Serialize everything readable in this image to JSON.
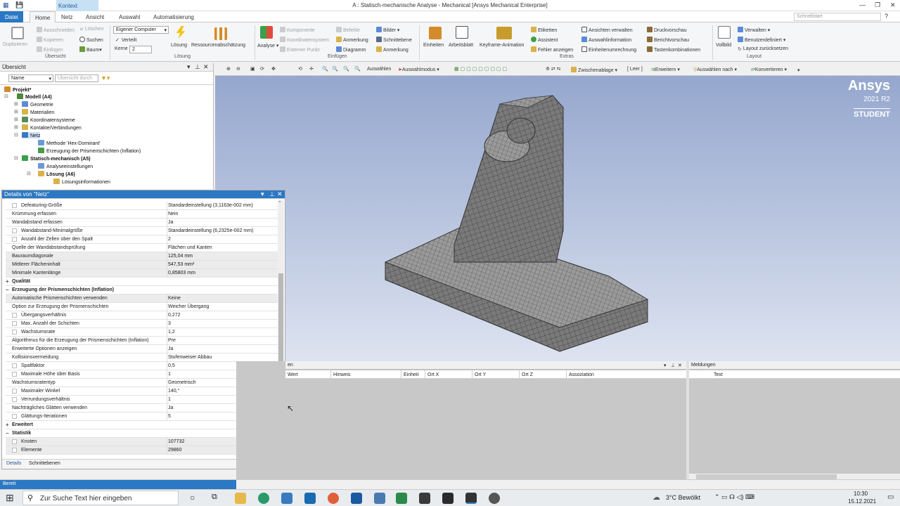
{
  "window": {
    "title": "A : Statisch-mechanische Analyse - Mechanical [Ansys Mechanical Enterprise]",
    "context_tab": "Kontext"
  },
  "tabs": [
    "Datei",
    "Home",
    "Netz",
    "Ansicht",
    "Auswahl",
    "Automatisierung"
  ],
  "search_placeholder": "Schnellstart",
  "ribbon": {
    "duplizieren": "Duplizieren",
    "ausschneiden": "Ausschneiden",
    "kopieren": "Kopieren",
    "einfuegen": "Einfügen",
    "loeschen": "Löschen",
    "suchen": "Suchen",
    "baum": "Baum",
    "uebersicht_grp": "Übersicht",
    "computer_select": "Eigener Computer",
    "verteilt": "Verteilt",
    "kerne_label": "Kerne",
    "kerne_value": "2",
    "loesung": "Lösung",
    "ressourcen": "Ressourcenabschätzung",
    "loesung_grp": "Lösung",
    "analyse": "Analyse",
    "komponente": "Komponente",
    "koordinatensystem": "Koordinatensystem",
    "externer_punkt": "Externer Punkt",
    "befehle": "Befehle",
    "anmerkung": "Anmerkung",
    "diagramm": "Diagramm",
    "bilder": "Bilder",
    "schnittebene": "Schnittebene",
    "anmerkung2": "Anmerkung",
    "einfuegen_grp": "Einfügen",
    "einheiten": "Einheiten",
    "arbeitsblatt": "Arbeitsblatt",
    "keyframe": "Keyframe-Animation",
    "etiketten": "Etiketten",
    "assistent": "Assistent",
    "fehler": "Fehler anzeigen",
    "ansichten": "Ansichten verwalten",
    "auswahlinfo": "Auswahlinformation",
    "einheitenumr": "Einheitenumrechnung",
    "druckvorschau": "Druckvorschau",
    "berichtvorschau": "Berichtvorschau",
    "tastenkomb": "Tastenkombinationen",
    "extras_grp": "Extras",
    "vollbild": "Vollbild",
    "verwalten": "Verwalten",
    "benutzerdef": "Benutzerdefiniert",
    "layout_reset": "Layout zurücksetzen",
    "layout_grp": "Layout"
  },
  "outline": {
    "title": "Übersicht",
    "name_col": "Name",
    "search_placeholder": "Übersicht durch",
    "nodes": [
      "Projekt*",
      "Modell (A4)",
      "Geometrie",
      "Materialien",
      "Koordinatensysteme",
      "Kontakte/Verbindungen",
      "Netz",
      "Methode 'Hex-Dominant'",
      "Erzeugung der Prismenschichten (Inflation)",
      "Statisch-mechanisch (A5)",
      "Analyseeinstellungen",
      "Lösung (A6)",
      "Lösungsinformationen"
    ]
  },
  "details": {
    "title": "Details von \"Netz\"",
    "rows": [
      {
        "k": "Defeaturing-Größe",
        "v": "Standardeinstellung (3,1163e-002 mm)"
      },
      {
        "k": "Krümmung erfassen",
        "v": "Nein"
      },
      {
        "k": "Wandabstand erfassen",
        "v": "Ja"
      },
      {
        "k": "Wandabstand-Minimalgröße",
        "v": "Standardeinstellung (6,2325e-002 mm)"
      },
      {
        "k": "Anzahl der Zellen über den Spalt",
        "v": "2"
      },
      {
        "k": "Quelle der Wandabstandsprüfung",
        "v": "Flächen und Kanten"
      },
      {
        "k": "Bauraumdiagonale",
        "v": "125,04 mm"
      },
      {
        "k": "Mittlerer Flächeninhalt",
        "v": "547,53 mm²"
      },
      {
        "k": "Minimale Kantenlänge",
        "v": "0,85803 mm"
      },
      {
        "k": "Qualität",
        "v": ""
      },
      {
        "k": "Erzeugung der Prismenschichten (Inflation)",
        "v": ""
      },
      {
        "k": "Automatische Prismenschichten verwenden",
        "v": "Keine"
      },
      {
        "k": "Option zur Erzeugung der Prismenschichten",
        "v": "Weicher Übergang"
      },
      {
        "k": "Übergangsverhältnis",
        "v": "0,272"
      },
      {
        "k": "Max. Anzahl der Schichten",
        "v": "3"
      },
      {
        "k": "Wachstumsrate",
        "v": "1,2"
      },
      {
        "k": "Algorithmus für die Erzeugung der Prismenschichten (Inflation)",
        "v": "Pre"
      },
      {
        "k": "Erweiterte Optionen anzeigen",
        "v": "Ja"
      },
      {
        "k": "Kollisionsvermeidung",
        "v": "Stufenweiser Abbau"
      },
      {
        "k": "Spaltfaktor",
        "v": "0,5"
      },
      {
        "k": "Maximale Höhe über Basis",
        "v": "1"
      },
      {
        "k": "Wachstumsratentyp",
        "v": "Geometrisch"
      },
      {
        "k": "Maximaler Winkel",
        "v": "140,°"
      },
      {
        "k": "Verrundungsverhältnis",
        "v": "1"
      },
      {
        "k": "Nachträgliches Glätten verwenden",
        "v": "Ja"
      },
      {
        "k": "Glättungs-Iterationen",
        "v": "5"
      },
      {
        "k": "Erweitert",
        "v": ""
      },
      {
        "k": "Statistik",
        "v": ""
      },
      {
        "k": "Knoten",
        "v": "107732"
      },
      {
        "k": "Elemente",
        "v": "29860"
      }
    ],
    "tab_details": "Details",
    "tab_schnitt": "Schnittebenen"
  },
  "viewtb": {
    "auswaehlen": "Auswählen",
    "auswahlmodus": "Auswahlmodus",
    "zwischenablage": "Zwischenablage",
    "leer": "[ Leer ]",
    "erweitern": "Erweitern",
    "auswaehlen_nach": "Auswählen nach",
    "konvertieren": "Konvertieren"
  },
  "brand": {
    "name": "Ansys",
    "version": "2021 R2",
    "edition": "STUDENT"
  },
  "bottom": {
    "left_title": "en",
    "cols": [
      "Wert",
      "Hinweis",
      "Einheit",
      "Ort X",
      "Ort Y",
      "Ort Z",
      "Assoziation"
    ],
    "right_title": "Meldungen",
    "right_col": "Text"
  },
  "status": "Bereit",
  "taskbar": {
    "search": "Zur Suche Text hier eingeben",
    "weather": "3°C  Bewölkt",
    "time": "10:30",
    "date": "15.12.2021"
  }
}
